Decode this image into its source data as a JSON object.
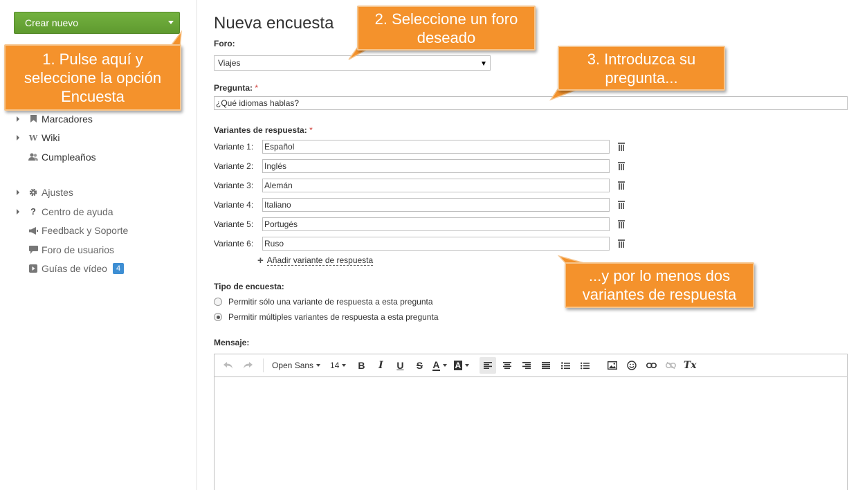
{
  "sidebar": {
    "create_button": "Crear nuevo",
    "items": [
      {
        "label": "Marcadores",
        "icon": "bookmark-icon",
        "expandable": true
      },
      {
        "label": "Wiki",
        "icon": "wiki-icon",
        "expandable": true
      },
      {
        "label": "Cumpleaños",
        "icon": "people-icon",
        "expandable": false
      },
      {
        "label": "Ajustes",
        "icon": "gear-icon",
        "expandable": true
      },
      {
        "label": "Centro de ayuda",
        "icon": "question-icon",
        "expandable": true
      },
      {
        "label": "Feedback y Soporte",
        "icon": "megaphone-icon",
        "expandable": false
      },
      {
        "label": "Foro de usuarios",
        "icon": "chat-bubble-icon",
        "expandable": false
      },
      {
        "label": "Guías de vídeo",
        "icon": "play-icon",
        "expandable": false,
        "badge": "4"
      }
    ]
  },
  "form": {
    "title": "Nueva encuesta",
    "forum_label": "Foro:",
    "forum_value": "Viajes",
    "question_label": "Pregunta:",
    "required_mark": "*",
    "question_value": "¿Qué idiomas hablas?",
    "variants_label": "Variantes de respuesta:",
    "variants": [
      {
        "label": "Variante 1:",
        "value": "Español"
      },
      {
        "label": "Variante 2:",
        "value": "Inglés"
      },
      {
        "label": "Variante 3:",
        "value": "Alemán"
      },
      {
        "label": "Variante 4:",
        "value": "Italiano"
      },
      {
        "label": "Variante 5:",
        "value": "Portugés"
      },
      {
        "label": "Variante 6:",
        "value": "Ruso"
      }
    ],
    "add_variant": "Añadir variante de respuesta",
    "poll_type_label": "Tipo de encuesta:",
    "poll_types": [
      {
        "label": "Permitir sólo una variante de respuesta a esta pregunta",
        "checked": false
      },
      {
        "label": "Permitir múltiples variantes de respuesta a esta pregunta",
        "checked": true
      }
    ],
    "message_label": "Mensaje:"
  },
  "editor": {
    "font_family": "Open Sans",
    "font_size": "14",
    "bold": "B",
    "italic": "I",
    "underline": "U",
    "strike": "S",
    "font_color": "A",
    "bg_color": "A",
    "clear_format": "Tx"
  },
  "callouts": {
    "step1": "1. Pulse aquí y seleccione la opción Encuesta",
    "step2": "2. Seleccione un foro deseado",
    "step3": "3. Introduzca su pregunta...",
    "step4": "...y por lo menos dos variantes de respuesta"
  },
  "colors": {
    "create_button": "#6aa838",
    "callout": "#f4922c",
    "badge": "#3d8ed3",
    "required": "#d0403b"
  }
}
